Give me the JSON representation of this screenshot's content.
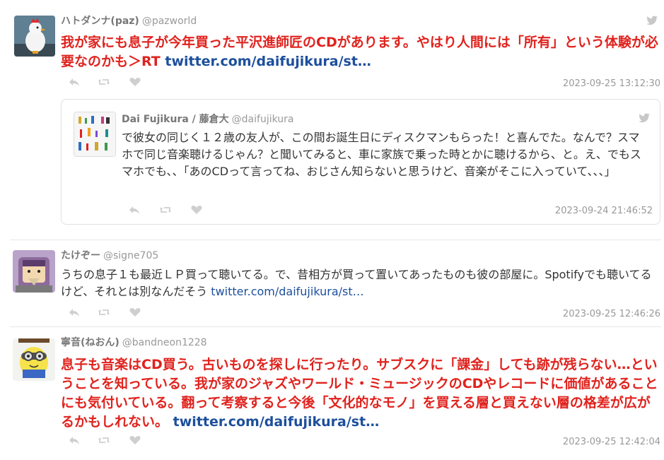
{
  "tweets": [
    {
      "name": "ハトダンナ(paz)",
      "handle": "@pazworld",
      "text": "我が家にも息子が今年買った平沢進師匠のCDがあります。やはり人間には「所有」という体験が必要なのかも＞RT ",
      "link": "twitter.com/daifujikura/st…",
      "timestamp": "2023-09-25 13:12:30",
      "quoted": {
        "name": "Dai Fujikura / 藤倉大",
        "handle": "@daifujikura",
        "text": "で彼女の同じく１２歳の友人が、この間お誕生日にディスクマンもらった！と喜んでた。なんで？スマホで同じ音楽聴けるじゃん？と聞いてみると、車に家族で乗った時とかに聴けるから、と。え、でもスマホでも、、「あのCDって言ってね、おじさん知らないと思うけど、音楽がそこに入っていて、、、」",
        "timestamp": "2023-09-24 21:46:52"
      }
    },
    {
      "name": "たけぞー",
      "handle": "@signe705",
      "text": "うちの息子１も最近ＬＰ買って聴いてる。で、昔相方が買って置いてあったものも彼の部屋に。Spotifyでも聴いてるけど、それとは別なんだそう ",
      "link": "twitter.com/daifujikura/st…",
      "timestamp": "2023-09-25 12:46:26"
    },
    {
      "name": "寧音(ねおん)",
      "handle": "@bandneon1228",
      "text": "息子も音楽はCD買う。古いものを探しに行ったり。サブスクに「課金」しても跡が残らない…ということを知っている。我が家のジャズやワールド・ミュージックのCDやレコードに価値があることにも気付いている。翻って考察すると今後「文化的なモノ」を買える層と買えない層の格差が広がるかもしれない。 ",
      "link": "twitter.com/daifujikura/st…",
      "timestamp": "2023-09-25 12:42:04"
    }
  ],
  "icons": {
    "reply": "reply-icon",
    "retweet": "retweet-icon",
    "like": "heart-icon",
    "bird": "twitter-bird-icon"
  },
  "colors": {
    "highlight_text": "#e0221d",
    "link": "#1d4f9c",
    "meta": "#999999"
  }
}
